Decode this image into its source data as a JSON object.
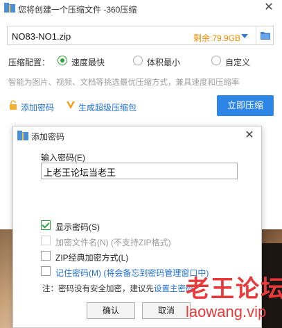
{
  "main_window": {
    "title": "您将创建一个压缩文件 -360压缩",
    "path": {
      "filename": "NO83-NO1.zip",
      "remaining": "剩余:79.9GB"
    },
    "config": {
      "label": "压缩配置：",
      "options": [
        {
          "label": "速度最快",
          "selected": true
        },
        {
          "label": "体积最小",
          "selected": false
        },
        {
          "label": "自定义",
          "selected": false
        }
      ]
    },
    "hint": "智能为图片、视频、文档等挑选最优压缩方式，兼具速度和压缩率",
    "add_password_link": "添加密码",
    "super_package_link": "生成超级压缩包",
    "compress_button": "立即压缩"
  },
  "dialog": {
    "title": "添加密码",
    "password_label": "输入密码(E)",
    "password_value": "上老王论坛当老王",
    "checkboxes": [
      {
        "label": "显示密码(S)",
        "checked": true,
        "disabled": false
      },
      {
        "label": "加密文件名(N) (不支持ZIP格式)",
        "checked": false,
        "disabled": true
      },
      {
        "label": "ZIP经典加密方式(L)",
        "checked": false,
        "disabled": false
      },
      {
        "label": "记住密码(M) (将会备忘到密码管理窗口中)",
        "checked": false,
        "disabled": false
      }
    ],
    "note_prefix": "注：密码没有安全加密，建议先",
    "note_link": "设置主密码",
    "ok_button": "确认",
    "cancel_button": "取消"
  },
  "watermark": {
    "text": "老王论坛",
    "url": "laowang.vip"
  },
  "colors": {
    "accent_blue": "#2d86e6",
    "link_blue": "#1f6fd6",
    "remain_orange": "#f08a00",
    "check_green": "#2aa43a",
    "watermark_red": "#e83a3a"
  }
}
